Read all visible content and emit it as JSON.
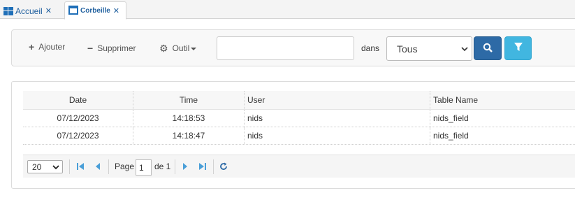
{
  "tabs": [
    {
      "label": "Accueil",
      "icon": "windows-icon",
      "close": "✕"
    },
    {
      "label": "Corbeille",
      "icon": "window-icon",
      "close": "✕"
    }
  ],
  "toolbar": {
    "add_label": "Ajouter",
    "delete_label": "Supprimer",
    "tool_label": "Outil",
    "search_value": "",
    "search_placeholder": "",
    "in_label": "dans",
    "scope_value": "Tous"
  },
  "grid": {
    "columns": [
      "Date",
      "Time",
      "User",
      "Table Name"
    ],
    "rows": [
      [
        "07/12/2023",
        "14:18:53",
        "nids",
        "nids_field"
      ],
      [
        "07/12/2023",
        "14:18:47",
        "nids",
        "nids_field"
      ]
    ]
  },
  "pager": {
    "page_size": "20",
    "page_label": "Page",
    "page_value": "1",
    "of_label": "de 1"
  },
  "colors": {
    "accent": "#2d6aa6",
    "filter": "#41b6e0",
    "pager_icon": "#4a9fd8"
  }
}
